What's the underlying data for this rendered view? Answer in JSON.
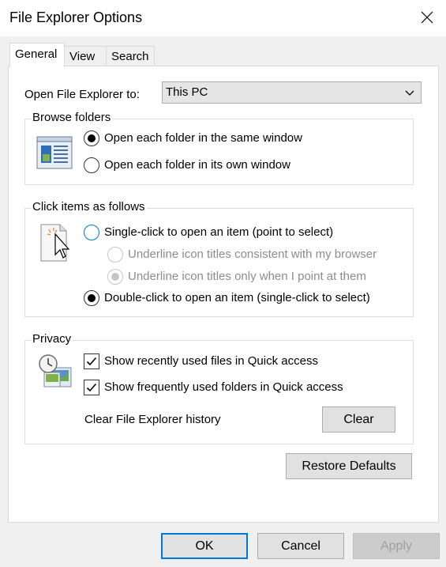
{
  "window": {
    "title": "File Explorer Options"
  },
  "tabs": [
    {
      "label": "General",
      "active": true
    },
    {
      "label": "View",
      "active": false
    },
    {
      "label": "Search",
      "active": false
    }
  ],
  "open_to": {
    "label": "Open File Explorer to:",
    "value": "This PC"
  },
  "browse_folders": {
    "legend": "Browse folders",
    "icon": "folder-window-icon",
    "options": [
      {
        "label": "Open each folder in the same window",
        "checked": true
      },
      {
        "label": "Open each folder in its own window",
        "checked": false
      }
    ]
  },
  "click_items": {
    "legend": "Click items as follows",
    "icon": "pointer-click-icon",
    "single_click": "Single-click to open an item (point to select)",
    "underline_browser": "Underline icon titles consistent with my browser",
    "underline_point": "Underline icon titles only when I point at them",
    "double_click": "Double-click to open an item (single-click to select)"
  },
  "privacy": {
    "legend": "Privacy",
    "icon": "clock-pictures-icon",
    "recent_files": "Show recently used files in Quick access",
    "frequent_folders": "Show frequently used folders in Quick access",
    "clear_history_label": "Clear File Explorer history",
    "clear_button": "Clear"
  },
  "restore_defaults": "Restore Defaults",
  "footer": {
    "ok": "OK",
    "cancel": "Cancel",
    "apply": "Apply"
  },
  "colors": {
    "accent": "#0078d7",
    "panel": "#ffffff",
    "background": "#f0f0f0"
  }
}
